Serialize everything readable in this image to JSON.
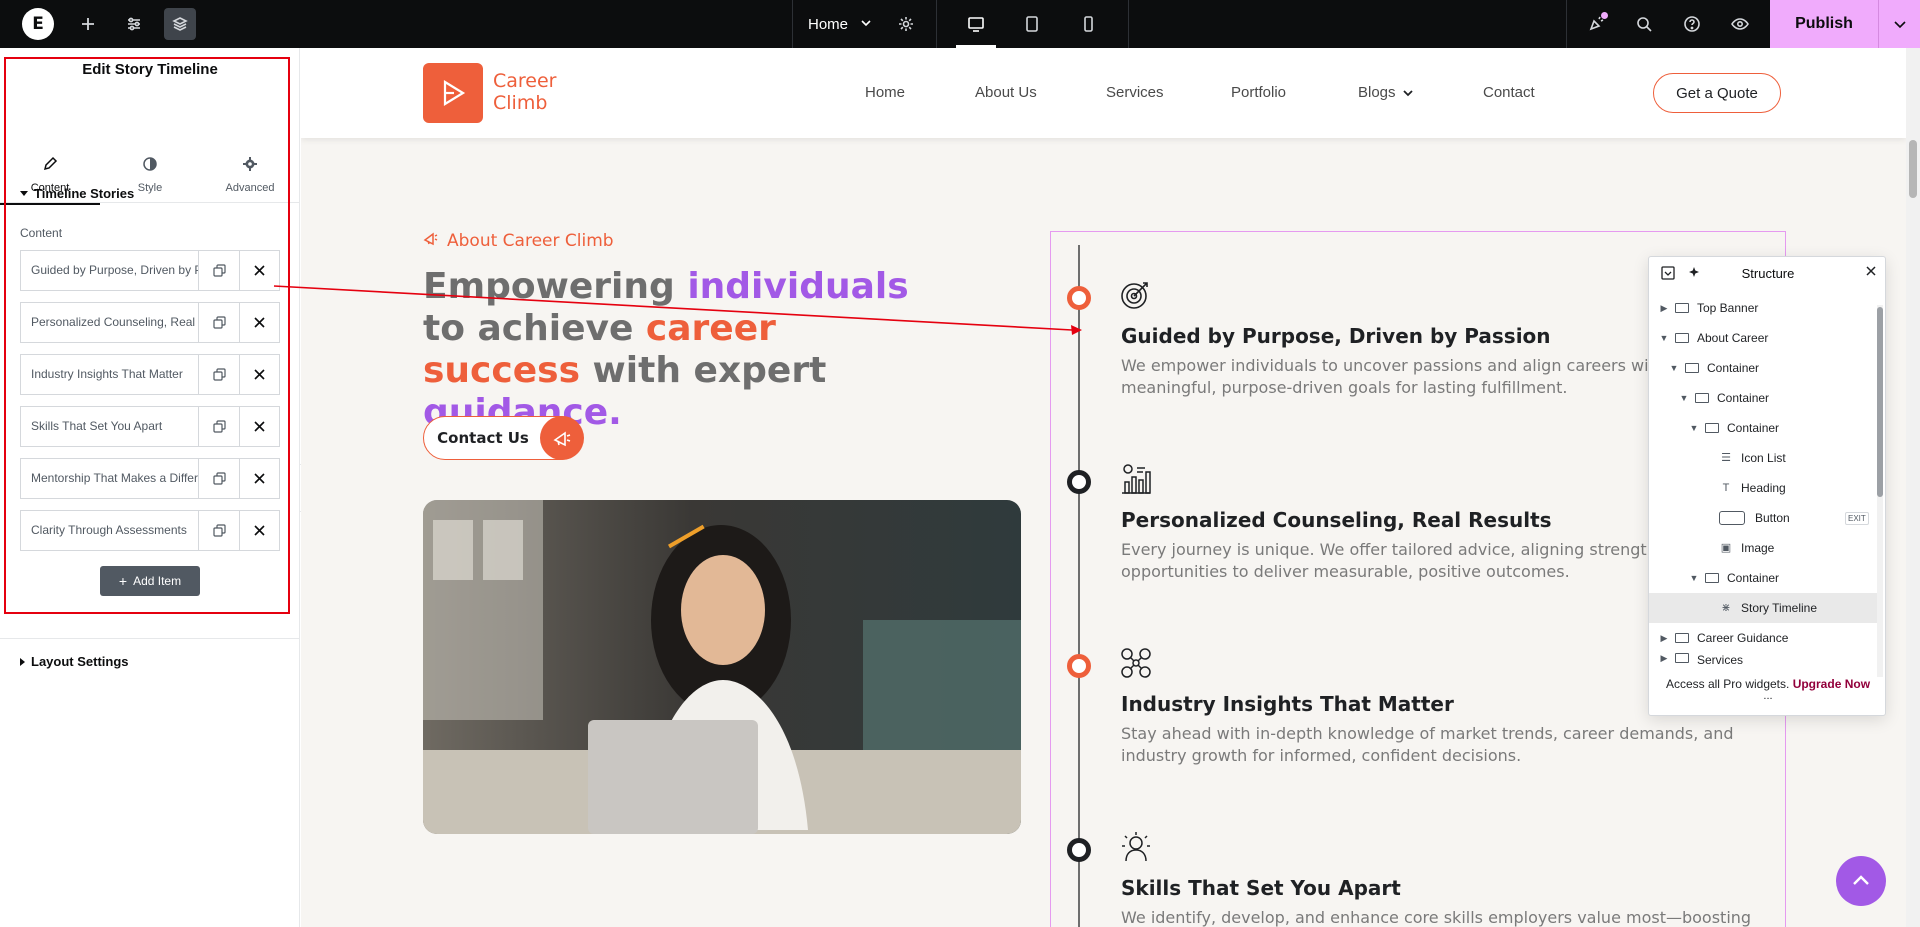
{
  "topbar": {
    "page_name": "Home",
    "publish_label": "Publish",
    "icons": [
      "elementor-logo",
      "add-icon",
      "sliders-icon",
      "layers-icon",
      "settings-icon",
      "desktop-icon",
      "tablet-icon",
      "mobile-icon",
      "whats-new-icon",
      "search-icon",
      "help-icon",
      "preview-icon",
      "chevron-down-icon"
    ]
  },
  "panel": {
    "title": "Edit Story Timeline",
    "tabs": [
      {
        "label": "Content",
        "icon": "pencil-icon"
      },
      {
        "label": "Style",
        "icon": "half-circle-icon"
      },
      {
        "label": "Advanced",
        "icon": "gear-icon"
      }
    ],
    "section_title": "Timeline Stories",
    "content_label": "Content",
    "items": [
      {
        "title": "Guided by Purpose, Driven by P"
      },
      {
        "title": "Personalized Counseling, Real"
      },
      {
        "title": "Industry Insights That Matter"
      },
      {
        "title": "Skills That Set You Apart"
      },
      {
        "title": "Mentorship That Makes a Differ"
      },
      {
        "title": "Clarity Through Assessments"
      }
    ],
    "add_item_label": "Add Item",
    "layout_section_title": "Layout Settings"
  },
  "site": {
    "logo_text": "Career Climb",
    "nav": [
      "Home",
      "About Us",
      "Services",
      "Portfolio",
      "Blogs",
      "Contact"
    ],
    "quote_button": "Get a Quote",
    "eyebrow": "About Career Climb",
    "headline": {
      "p1": "Empowering ",
      "p2": "individuals",
      "p3": " to achieve ",
      "p4": "career success",
      "p5": " with expert ",
      "p6": "guidance."
    },
    "contact_button": "Contact Us",
    "colors": {
      "accent": "#ee5f3b",
      "purple": "#a259e6",
      "dark": "#1f2124"
    }
  },
  "timeline": [
    {
      "title": "Guided by Purpose, Driven by Passion",
      "desc": "We empower individuals to uncover passions and align careers with meaningful, purpose-driven goals for lasting fulfillment.",
      "dot": "orange",
      "icon": "target-icon"
    },
    {
      "title": "Personalized Counseling, Real Results",
      "desc": "Every journey is unique. We offer tailored advice, aligning strengths with opportunities to deliver measurable, positive outcomes.",
      "dot": "dark",
      "icon": "chart-icon"
    },
    {
      "title": "Industry Insights That Matter",
      "desc": "Stay ahead with in-depth knowledge of market trends, career demands, and industry growth for informed, confident decisions.",
      "dot": "orange",
      "icon": "network-icon"
    },
    {
      "title": "Skills That Set You Apart",
      "desc": "We identify, develop, and enhance core skills employers value most—boosting",
      "dot": "dark",
      "icon": "skills-icon"
    }
  ],
  "structure": {
    "title": "Structure",
    "rows": [
      {
        "label": "Top Banner",
        "arrow": "right",
        "type": "container"
      },
      {
        "label": "About Career",
        "arrow": "down",
        "type": "container"
      },
      {
        "label": "Container",
        "arrow": "down",
        "type": "container"
      },
      {
        "label": "Container",
        "arrow": "down",
        "type": "container"
      },
      {
        "label": "Container",
        "arrow": "down",
        "type": "container"
      },
      {
        "label": "Icon List",
        "arrow": "",
        "type": "widget",
        "icon": "list-icon"
      },
      {
        "label": "Heading",
        "arrow": "",
        "type": "widget",
        "icon": "heading-icon"
      },
      {
        "label": "Button",
        "arrow": "",
        "type": "widget",
        "icon": "button-icon"
      },
      {
        "label": "Image",
        "arrow": "",
        "type": "widget",
        "icon": "image-icon"
      },
      {
        "label": "Container",
        "arrow": "down",
        "type": "container"
      },
      {
        "label": "Story Timeline",
        "arrow": "",
        "type": "widget",
        "icon": "timeline-icon"
      },
      {
        "label": "Career Guidance",
        "arrow": "right",
        "type": "container"
      },
      {
        "label": "Services",
        "arrow": "right",
        "type": "container"
      }
    ],
    "exit_tag": "EXIT",
    "footer_text": "Access all Pro widgets.",
    "footer_link": "Upgrade Now",
    "footer_more": "..."
  }
}
